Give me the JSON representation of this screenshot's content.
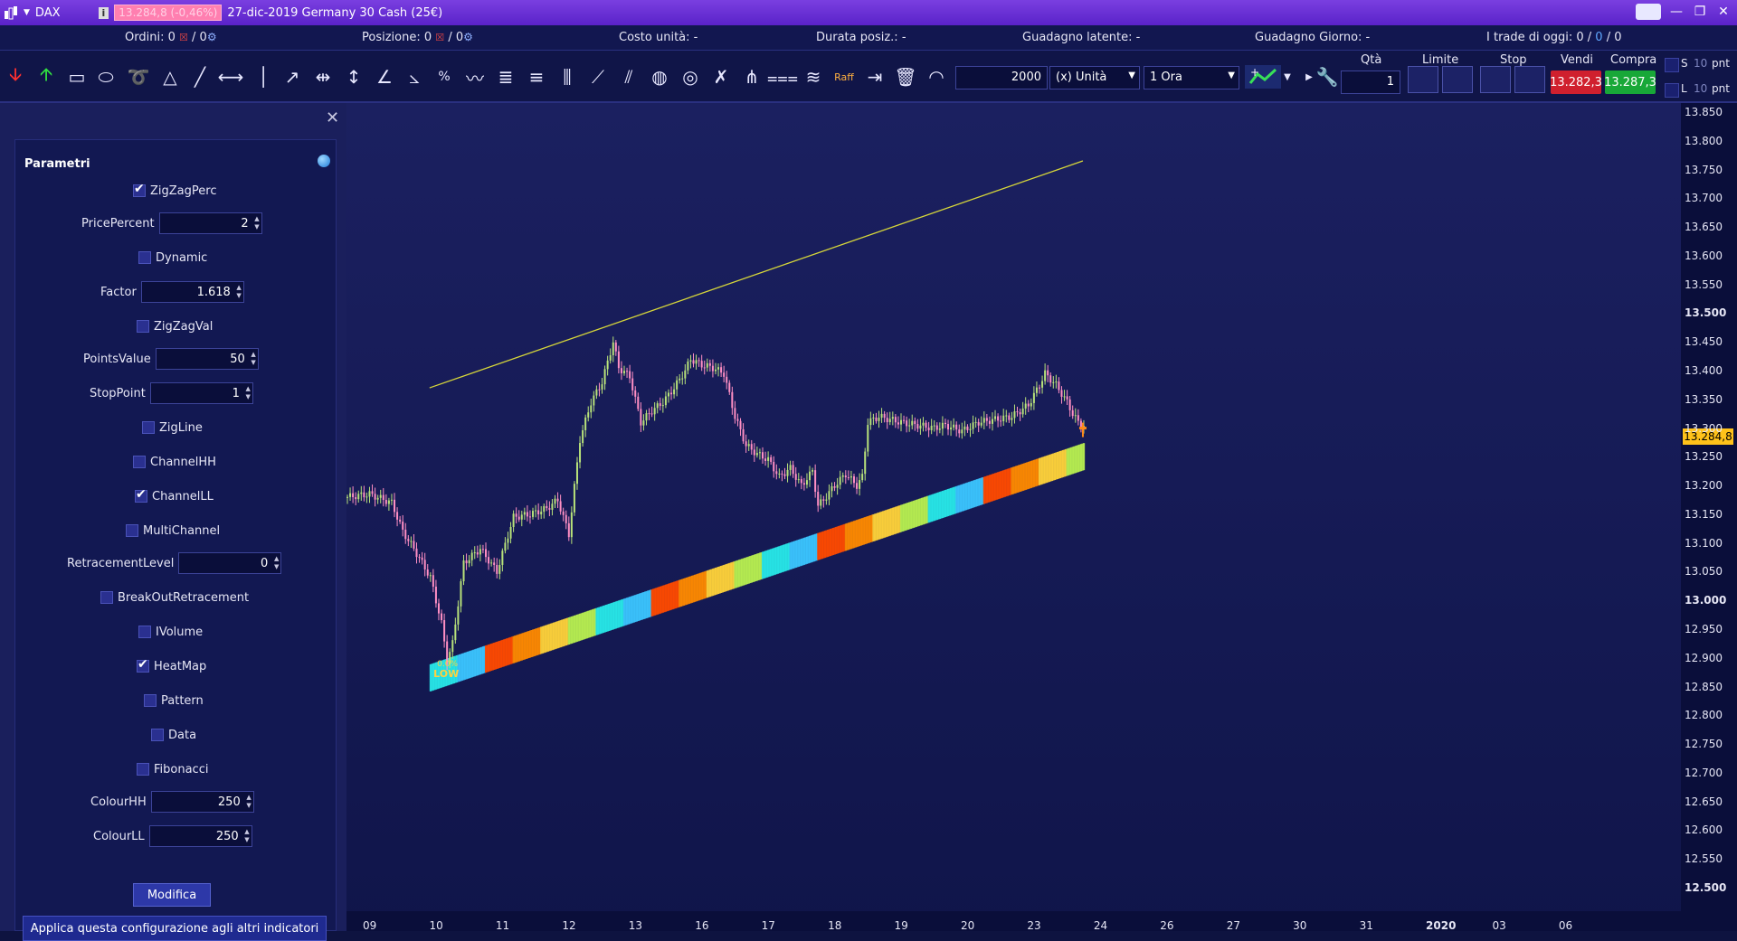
{
  "titlebar": {
    "symbol": "DAX",
    "price_badge": "13.284,8 (-0,46%)",
    "instrument": "27-dic-2019 Germany 30 Cash (25€)"
  },
  "status": {
    "ordini_label": "Ordini:",
    "ordini_value": "0",
    "ordini_total": "/ 0",
    "posizione_label": "Posizione:",
    "posizione_value": "0",
    "posizione_total": "/ 0",
    "costo_unita": "Costo unità: -",
    "durata_posiz": "Durata posiz.: -",
    "guadagno_latente": "Guadagno latente: -",
    "guadagno_giorno": "Guadagno Giorno: -",
    "trade_oggi_label": "I trade di oggi:",
    "trade_oggi_a": "0",
    "trade_oggi_b": "0",
    "trade_oggi_c": "0"
  },
  "toolbar": {
    "quantity": "2000",
    "unit": "(x) Unità",
    "timeframe": "1 Ora",
    "qta_label": "Qtà",
    "qta_value": "1",
    "limite_label": "Limite",
    "stop_label": "Stop",
    "vendi_label": "Vendi",
    "compra_label": "Compra",
    "vendi_price": "13.282,3",
    "compra_price": "13.287,3",
    "s_label": "S",
    "l_label": "L",
    "s_value": "10",
    "l_value": "10",
    "pnt": "pnt",
    "raff": "Raff"
  },
  "panel": {
    "title": "Parametri",
    "zigzagperc": "ZigZagPerc",
    "pricepercent_label": "PricePercent",
    "pricepercent_value": "2",
    "dynamic": "Dynamic",
    "factor_label": "Factor",
    "factor_value": "1.618",
    "zigzagval": "ZigZagVal",
    "pointsvalue_label": "PointsValue",
    "pointsvalue_value": "50",
    "stoppoint_label": "StopPoint",
    "stoppoint_value": "1",
    "zigline": "ZigLine",
    "channelhh": "ChannelHH",
    "channelll": "ChannelLL",
    "multichannel": "MultiChannel",
    "retracement_label": "RetracementLevel",
    "retracement_value": "0",
    "breakout": "BreakOutRetracement",
    "ivolume": "IVolume",
    "heatmap": "HeatMap",
    "pattern": "Pattern",
    "data": "Data",
    "fibonacci": "Fibonacci",
    "colourhh_label": "ColourHH",
    "colourhh_value": "250",
    "colourll_label": "ColourLL",
    "colourll_value": "250",
    "modifica": "Modifica",
    "applica": "Applica questa configurazione agli altri indicatori"
  },
  "chart_labels": {
    "low_label": "LOW",
    "low_pct": "0.0%",
    "last_price": "13.284,8"
  },
  "chart_data": {
    "type": "candlestick",
    "y_ticks": [
      "13.850",
      "13.800",
      "13.750",
      "13.700",
      "13.650",
      "13.600",
      "13.550",
      "13.500",
      "13.450",
      "13.400",
      "13.350",
      "13.300",
      "13.250",
      "13.200",
      "13.150",
      "13.100",
      "13.050",
      "13.000",
      "12.950",
      "12.900",
      "12.850",
      "12.800",
      "12.750",
      "12.700",
      "12.650",
      "12.600",
      "12.550",
      "12.500"
    ],
    "bold_ticks": [
      "13.500",
      "13.000",
      "12.500"
    ],
    "ylim": [
      12500,
      13850
    ],
    "x_ticks": [
      "09",
      "10",
      "11",
      "12",
      "13",
      "16",
      "17",
      "18",
      "19",
      "20",
      "23",
      "24",
      "26",
      "27",
      "30",
      "31",
      "2020",
      "03",
      "06"
    ],
    "bold_x_ticks": [
      "2020"
    ],
    "x_tick_index": [
      0,
      24,
      48,
      72,
      96,
      120,
      144,
      168,
      192,
      216,
      240,
      264,
      288,
      312,
      336,
      360,
      384,
      408,
      432
    ],
    "close_points": [
      [
        0,
        13180
      ],
      [
        8,
        13185
      ],
      [
        16,
        13170
      ],
      [
        20,
        13120
      ],
      [
        24,
        13090
      ],
      [
        30,
        13040
      ],
      [
        34,
        12960
      ],
      [
        36,
        12895
      ],
      [
        38,
        12925
      ],
      [
        42,
        13065
      ],
      [
        48,
        13090
      ],
      [
        54,
        13050
      ],
      [
        60,
        13145
      ],
      [
        66,
        13150
      ],
      [
        72,
        13160
      ],
      [
        76,
        13175
      ],
      [
        80,
        13115
      ],
      [
        84,
        13280
      ],
      [
        88,
        13345
      ],
      [
        92,
        13380
      ],
      [
        96,
        13450
      ],
      [
        98,
        13405
      ],
      [
        102,
        13390
      ],
      [
        106,
        13310
      ],
      [
        110,
        13330
      ],
      [
        114,
        13345
      ],
      [
        118,
        13370
      ],
      [
        122,
        13400
      ],
      [
        124,
        13420
      ],
      [
        128,
        13410
      ],
      [
        132,
        13405
      ],
      [
        136,
        13395
      ],
      [
        140,
        13320
      ],
      [
        144,
        13270
      ],
      [
        148,
        13255
      ],
      [
        152,
        13245
      ],
      [
        156,
        13215
      ],
      [
        160,
        13230
      ],
      [
        164,
        13200
      ],
      [
        168,
        13225
      ],
      [
        170,
        13165
      ],
      [
        172,
        13175
      ],
      [
        176,
        13200
      ],
      [
        180,
        13220
      ],
      [
        184,
        13200
      ],
      [
        186,
        13215
      ],
      [
        188,
        13310
      ],
      [
        192,
        13320
      ],
      [
        196,
        13315
      ],
      [
        200,
        13310
      ],
      [
        206,
        13305
      ],
      [
        212,
        13300
      ],
      [
        216,
        13305
      ],
      [
        222,
        13295
      ],
      [
        228,
        13310
      ],
      [
        234,
        13315
      ],
      [
        240,
        13320
      ],
      [
        246,
        13340
      ],
      [
        250,
        13375
      ],
      [
        252,
        13395
      ],
      [
        256,
        13375
      ],
      [
        260,
        13345
      ],
      [
        262,
        13325
      ],
      [
        264,
        13310
      ],
      [
        266,
        13305
      ]
    ],
    "channel_upper": [
      [
        30,
        13370
      ],
      [
        266,
        13765
      ]
    ],
    "channel_lower": [
      [
        30,
        12870
      ],
      [
        266,
        13255
      ]
    ],
    "heatmap_colors": [
      "#ff8a00",
      "#ffd23a",
      "#b8f050",
      "#28e8e8",
      "#3cc6ff",
      "#ff4a00"
    ]
  }
}
